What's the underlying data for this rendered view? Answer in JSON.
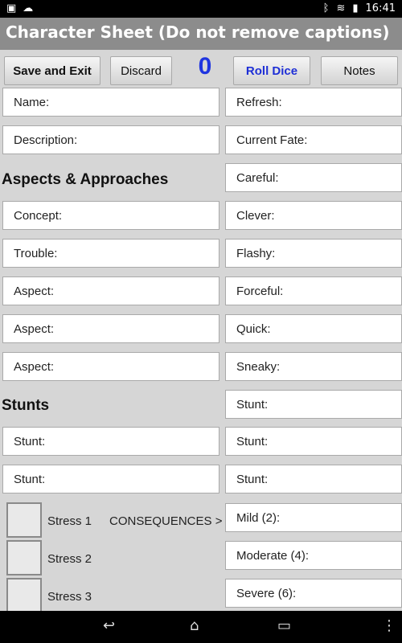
{
  "status_bar": {
    "time": "16:41",
    "left_icons": [
      "image-icon",
      "upload-cloud-icon"
    ],
    "right_icons": [
      "bluetooth-icon",
      "wifi-icon",
      "battery-icon"
    ]
  },
  "app": {
    "title": "Character Sheet (Do not remove captions)"
  },
  "toolbar": {
    "save_exit_label": "Save and Exit",
    "discard_label": "Discard",
    "counter_value": "0",
    "roll_dice_label": "Roll Dice",
    "notes_label": "Notes"
  },
  "fields": {
    "name": "Name:",
    "description": "Description:",
    "concept": "Concept:",
    "trouble": "Trouble:",
    "aspect1": "Aspect:",
    "aspect2": "Aspect:",
    "aspect3": "Aspect:",
    "stunt_left1": "Stunt:",
    "stunt_left2": "Stunt:",
    "refresh": "Refresh:",
    "current_fate": "Current Fate:",
    "careful": "Careful:",
    "clever": "Clever:",
    "flashy": "Flashy:",
    "forceful": "Forceful:",
    "quick": "Quick:",
    "sneaky": "Sneaky:",
    "stunt_right1": "Stunt:",
    "stunt_right2": "Stunt:",
    "stunt_right3": "Stunt:",
    "mild": "Mild (2):",
    "moderate": "Moderate (4):",
    "severe": "Severe (6):"
  },
  "sections": {
    "aspects": "Aspects & Approaches",
    "stunts": "Stunts"
  },
  "stress": {
    "labels": [
      "Stress 1",
      "Stress 2",
      "Stress 3"
    ],
    "consequences_label": "CONSEQUENCES >"
  },
  "colors": {
    "accent_blue": "#1f35e0",
    "title_bar": "#8c8c8c",
    "background": "#d6d6d6"
  }
}
